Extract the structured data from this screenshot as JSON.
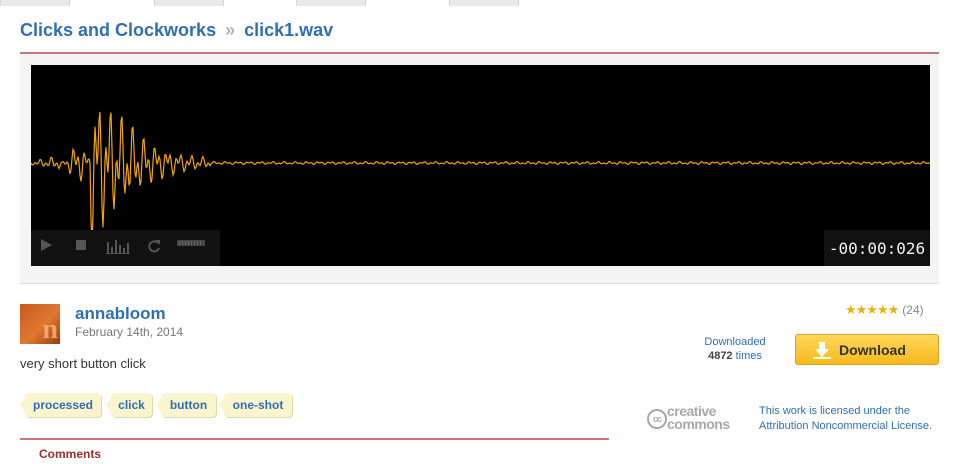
{
  "breadcrumb": {
    "pack": "Clicks and Clockworks",
    "separator": "»",
    "sound": "click1.wav"
  },
  "player": {
    "time": "-00:00:026",
    "waveform_color": "#f5a500",
    "controls": [
      "play-icon",
      "stop-icon",
      "spectrum-icon",
      "loop-icon",
      "volume-icon"
    ]
  },
  "uploader": {
    "username": "annabloom",
    "date": "February 14th, 2014"
  },
  "description": "very short button click",
  "tags": [
    "processed",
    "click",
    "button",
    "one-shot"
  ],
  "rating": {
    "stars": 4.5,
    "count": "(24)"
  },
  "downloads": {
    "label": "Downloaded",
    "count": "4872",
    "suffix": "times"
  },
  "download_button": {
    "label": "Download"
  },
  "cc_logo": {
    "line1": "creative",
    "line2": "commons",
    "mark": "cc"
  },
  "license": {
    "text": "This work is licensed under the Attribution Noncommercial License."
  },
  "comments": {
    "title": "Comments"
  },
  "colors": {
    "link": "#2f6fb3",
    "accent_line": "#c9777a",
    "download_button": "#f6b91d",
    "star": "#e8b30b"
  }
}
